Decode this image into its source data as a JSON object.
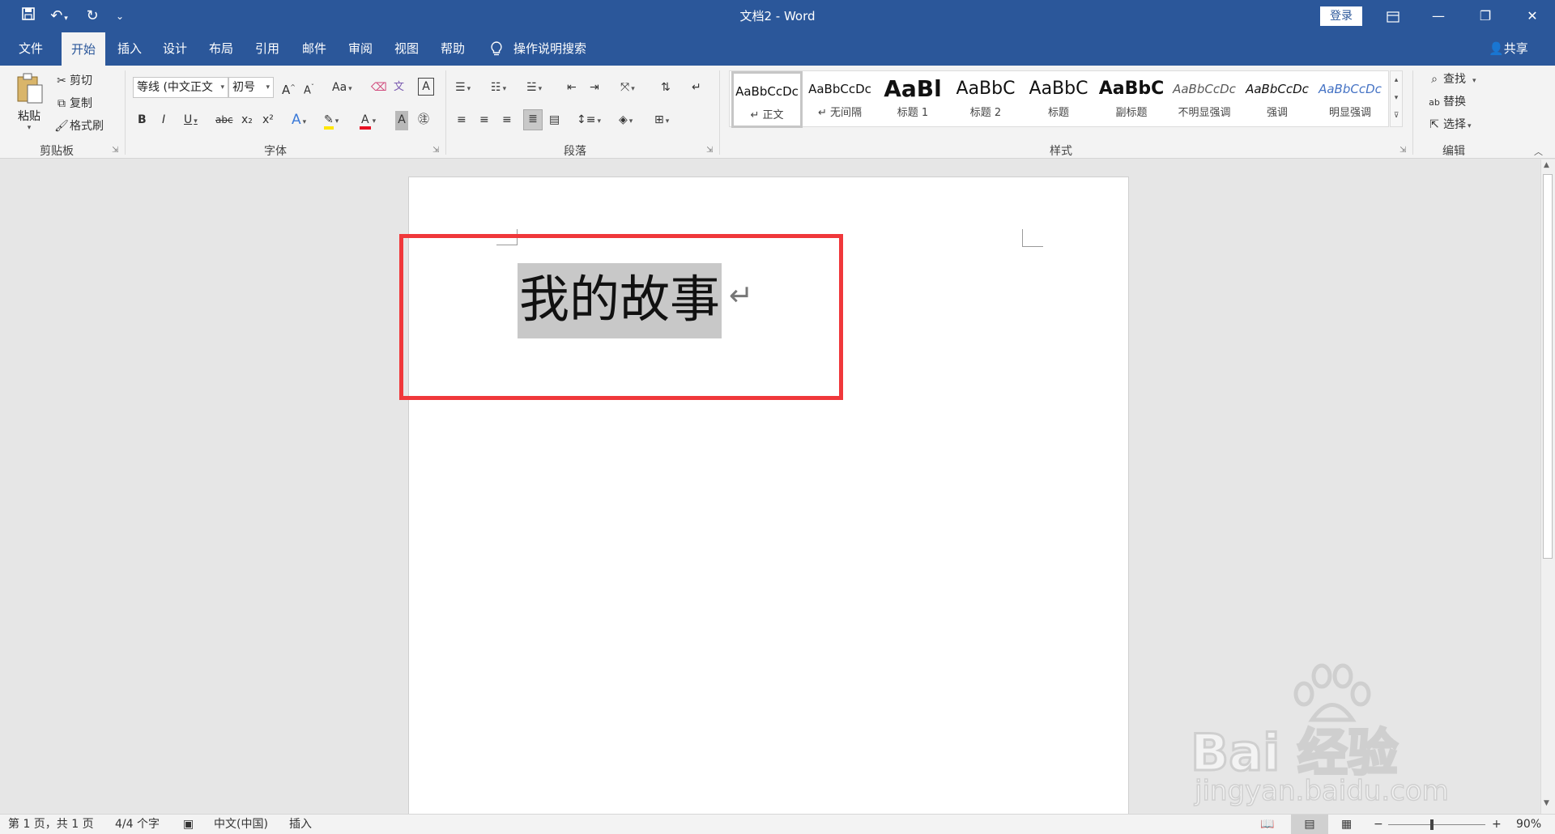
{
  "titlebar": {
    "title": "文档2 - Word",
    "signin_label": "登录",
    "undo_icon": "↶",
    "redo_icon": "↻",
    "save_icon": "💾",
    "customize_icon": "⌄"
  },
  "tabs": [
    "文件",
    "开始",
    "插入",
    "设计",
    "布局",
    "引用",
    "邮件",
    "审阅",
    "视图",
    "帮助"
  ],
  "tell_me": "操作说明搜索",
  "share": "共享",
  "clipboard": {
    "paste": "粘贴",
    "cut": "剪切",
    "copy": "复制",
    "format_painter": "格式刷",
    "label": "剪贴板"
  },
  "font": {
    "name": "等线 (中文正文",
    "size": "初号",
    "label": "字体",
    "bold": "B",
    "italic": "I",
    "underline": "U",
    "strike": "abc",
    "sub": "x₂",
    "sup": "x²",
    "grow": "A",
    "shrink": "A",
    "case": "Aa",
    "color_a": "A"
  },
  "paragraph": {
    "label": "段落"
  },
  "styles": {
    "label": "样式",
    "items": [
      {
        "preview": "AaBbCcDc",
        "name": "↵ 正文"
      },
      {
        "preview": "AaBbCcDc",
        "name": "↵ 无间隔"
      },
      {
        "preview": "AaBl",
        "name": "标题 1"
      },
      {
        "preview": "AaBbC",
        "name": "标题 2"
      },
      {
        "preview": "AaBbC",
        "name": "标题"
      },
      {
        "preview": "AaBbC",
        "name": "副标题"
      },
      {
        "preview": "AaBbCcDc",
        "name": "不明显强调"
      },
      {
        "preview": "AaBbCcDc",
        "name": "强调"
      },
      {
        "preview": "AaBbCcDc",
        "name": "明显强调"
      }
    ]
  },
  "editing": {
    "find": "查找",
    "replace": "替换",
    "select": "选择",
    "label": "编辑"
  },
  "document": {
    "text": "我的故事",
    "paragraph_mark": "↵"
  },
  "status": {
    "page": "第 1 页，共 1 页",
    "words": "4/4 个字",
    "language": "中文(中国)",
    "mode": "插入",
    "zoom": "90%"
  },
  "watermark": {
    "brand": "Bai 经验",
    "url": "jingyan.baidu.com"
  },
  "colors": {
    "ribbon_blue": "#2b579a",
    "highlight_box": "#f0383b",
    "selection": "#c8c8c8"
  }
}
